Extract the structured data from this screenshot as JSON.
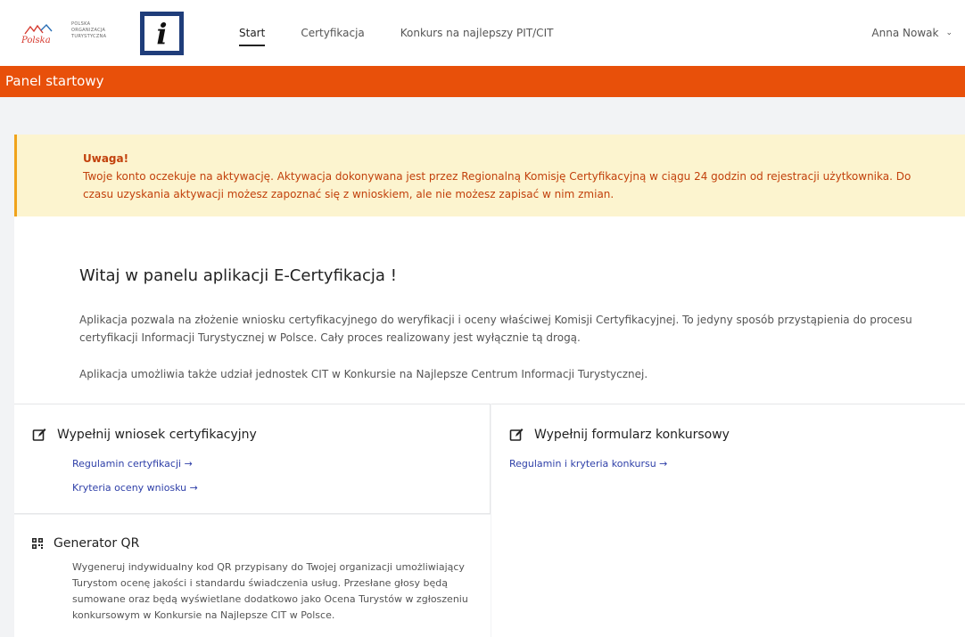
{
  "header": {
    "logo_polska_word": "Polska",
    "logo_pot_lines": [
      "POLSKA",
      "ORGANIZACJA",
      "TURYSTYCZNA"
    ],
    "logo_i_letter": "i",
    "nav": [
      {
        "label": "Start",
        "active": true
      },
      {
        "label": "Certyfikacja",
        "active": false
      },
      {
        "label": "Konkurs na najlepszy PIT/CIT",
        "active": false
      }
    ],
    "user_name": "Anna Nowak",
    "user_chevron": "⌄"
  },
  "page_title": "Panel startowy",
  "alert": {
    "title": "Uwaga!",
    "body": "Twoje konto oczekuje na aktywację. Aktywacja dokonywana jest przez Regionalną Komisję Certyfikacyjną w ciągu 24 godzin od rejestracji użytkownika. Do czasu uzyskania aktywacji możesz zapoznać się z wnioskiem, ale nie możesz zapisać w nim zmian."
  },
  "welcome": {
    "heading": "Witaj w panelu aplikacji E-Certyfikacja !",
    "p1": "Aplikacja pozwala na złożenie wniosku certyfikacyjnego do weryfikacji i oceny właściwej Komisji Certyfikacyjnej. To jedyny sposób przystąpienia do procesu certyfikacji Informacji Turystycznej w Polsce. Cały proces realizowany jest wyłącznie tą drogą.",
    "p2": "Aplikacja umożliwia także udział jednostek CIT w Konkursie na Najlepsze Centrum Informacji Turystycznej."
  },
  "cards": {
    "cert": {
      "title": "Wypełnij wniosek certyfikacyjny",
      "icon": "edit-icon",
      "links": [
        "Regulamin certyfikacji →",
        "Kryteria oceny wniosku →"
      ]
    },
    "konkurs": {
      "title": "Wypełnij formularz konkursowy",
      "icon": "edit-icon",
      "links": [
        "Regulamin i kryteria konkursu →"
      ]
    },
    "qr": {
      "title": "Generator QR",
      "icon": "qr-code-icon",
      "description": "Wygeneruj indywidualny kod QR przypisany do Twojej organizacji umożliwiający Turystom ocenę jakości i standardu świadczenia usług. Przesłane głosy będą sumowane oraz będą wyświetlane dodatkowo jako Ocena Turystów w zgłoszeniu konkursowym w Konkursie na Najlepsze CIT w Polsce."
    }
  },
  "colors": {
    "accent_orange": "#e8500a",
    "alert_bg": "#fcf4cf",
    "alert_text": "#c2410c",
    "link_blue": "#2e3fa8"
  }
}
